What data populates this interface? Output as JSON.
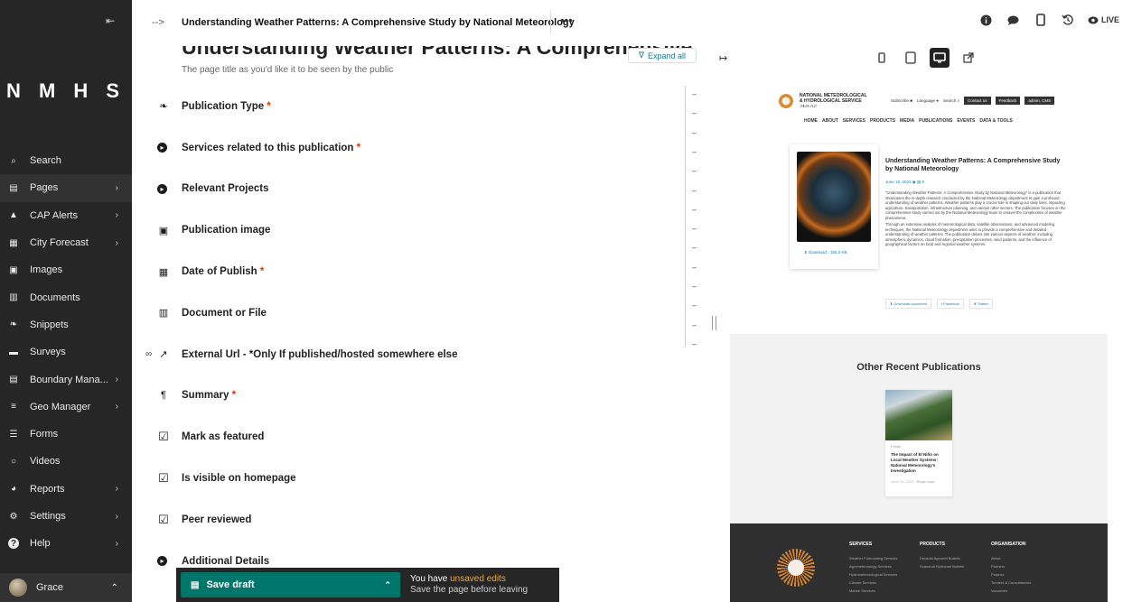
{
  "sidebar": {
    "collapse_icon": "collapse-left-icon",
    "logo": "N M H S",
    "items": [
      {
        "label": "Search",
        "icon": "search-icon",
        "chevron": false,
        "active": false
      },
      {
        "label": "Pages",
        "icon": "folder-open-icon",
        "chevron": true,
        "active": true
      },
      {
        "label": "CAP Alerts",
        "icon": "warning-icon",
        "chevron": true,
        "active": false
      },
      {
        "label": "City Forecast",
        "icon": "table-icon",
        "chevron": true,
        "active": false
      },
      {
        "label": "Images",
        "icon": "image-icon",
        "chevron": false,
        "active": false
      },
      {
        "label": "Documents",
        "icon": "document-icon",
        "chevron": false,
        "active": false
      },
      {
        "label": "Snippets",
        "icon": "leaf-icon",
        "chevron": false,
        "active": false
      },
      {
        "label": "Surveys",
        "icon": "folder-icon",
        "chevron": false,
        "active": false
      },
      {
        "label": "Boundary Mana...",
        "icon": "folder-open-icon",
        "chevron": true,
        "active": false
      },
      {
        "label": "Geo Manager",
        "icon": "layers-icon",
        "chevron": true,
        "active": false
      },
      {
        "label": "Forms",
        "icon": "form-icon",
        "chevron": false,
        "active": false
      },
      {
        "label": "Videos",
        "icon": "circle-icon",
        "chevron": false,
        "active": false
      },
      {
        "label": "Reports",
        "icon": "globe-icon",
        "chevron": true,
        "active": false
      },
      {
        "label": "Settings",
        "icon": "cogs-icon",
        "chevron": true,
        "active": false
      },
      {
        "label": "Help",
        "icon": "help-icon",
        "chevron": true,
        "active": false
      }
    ],
    "user": {
      "name": "Grace"
    }
  },
  "header": {
    "arrow": "-->",
    "title": "Understanding Weather Patterns: A Comprehensive Study by National Meteorology",
    "more": "•••",
    "live_label": "LIVE"
  },
  "editor": {
    "page_heading": "Understanding Weather Patterns: A Comprehensive Study by National Meteorology",
    "page_hint": "The page title as you'd like it to be seen by the public",
    "expand_all": "Expand all",
    "fields": [
      {
        "label": "Publication Type",
        "required": true,
        "icon": "leaf-icon"
      },
      {
        "label": "Services related to this publication",
        "required": true,
        "icon": "chevron-circle-icon"
      },
      {
        "label": "Relevant Projects",
        "required": false,
        "icon": "chevron-circle-icon"
      },
      {
        "label": "Publication image",
        "required": false,
        "icon": "image-icon"
      },
      {
        "label": "Date of Publish",
        "required": true,
        "icon": "calendar-icon"
      },
      {
        "label": "Document or File",
        "required": false,
        "icon": "document-icon"
      },
      {
        "label": "External Url - *Only If published/hosted somewhere else",
        "required": false,
        "icon": "external-link-icon",
        "link_icon": "link-icon"
      },
      {
        "label": "Summary",
        "required": true,
        "icon": "pilcrow-icon"
      },
      {
        "label": "Mark as featured",
        "required": false,
        "icon": "checkbox-icon"
      },
      {
        "label": "Is visible on homepage",
        "required": false,
        "icon": "checkbox-icon"
      },
      {
        "label": "Peer reviewed",
        "required": false,
        "icon": "checkbox-icon"
      },
      {
        "label": "Additional Details",
        "required": false,
        "icon": "chevron-circle-icon"
      }
    ],
    "minimap_marks": [
      "–",
      "–",
      "–",
      "–",
      "–",
      "–",
      "–",
      "–",
      "–",
      "–",
      "–",
      "–",
      "–",
      "–"
    ]
  },
  "savebar": {
    "button_label": "Save draft",
    "msg_prefix": "You have ",
    "msg_highlight": "unsaved edits",
    "msg_sub": "Save the page before leaving"
  },
  "preview": {
    "site": {
      "name_line1": "NATIONAL METEOROLOGICAL",
      "name_line2": "& HYDROLOGICAL SERVICE",
      "name_line3": "ጋፋመ ቢሮ",
      "tools": [
        "Subscribe",
        "Language",
        "Search"
      ],
      "buttons": [
        "Contact us",
        "Feedback",
        "admin, CMS"
      ],
      "nav": [
        "HOME",
        "ABOUT",
        "SERVICES",
        "PRODUCTS",
        "MEDIA",
        "PUBLICATIONS",
        "EVENTS",
        "DATA & TOOLS"
      ]
    },
    "publication": {
      "title": "Understanding Weather Patterns: A Comprehensive Study by National Meteorology",
      "date": "June 19, 2023",
      "views": "9",
      "download": "Download - 155.2 KB",
      "body_1": "\"Understanding Weather Patterns: A Comprehensive Study by National Meteorology\" is a publication that showcases the in-depth research conducted by the National Meteorology department to gain a profound understanding of weather patterns. Weather patterns play a crucial role in shaping our daily lives, impacting agriculture, transportation, infrastructure planning, and various other sectors. The publication focuses on the comprehensive study carried out by the National Meteorology team to unravel the complexities of weather phenomena.",
      "body_2": "Through an extensive analysis of meteorological data, satellite observations, and advanced modeling techniques, the National Meteorology department aims to provide a comprehensive and detailed understanding of weather patterns. The publication delves into various aspects of weather, including atmospheric dynamics, cloud formation, precipitation processes, wind patterns, and the influence of geographical factors on local and regional weather systems.",
      "actions": [
        "Download document",
        "Facebook",
        "Twitter"
      ]
    },
    "recent": {
      "title": "Other Recent Publications",
      "card": {
        "tag": "Poster",
        "title": "The Impact of El Niño on Local Weather Systems: National Meteorology's Investigation",
        "date": "June 19, 2023",
        "read_more": "Read more"
      }
    },
    "footer": {
      "columns": [
        {
          "head": "SERVICES",
          "links": [
            "Weather Forecasting Services",
            "Agrometeorology Services",
            "Hydrometeorological Services",
            "Climate Services",
            "Marine Services"
          ]
        },
        {
          "head": "PRODUCTS",
          "links": [
            "Decadal Agromet Bulletin",
            "Seasonal Hydromet Bulletin"
          ]
        },
        {
          "head": "ORGANISATION",
          "links": [
            "About",
            "Partners",
            "Projects",
            "Tenders & Consultancies",
            "Vacancies"
          ]
        }
      ]
    }
  }
}
